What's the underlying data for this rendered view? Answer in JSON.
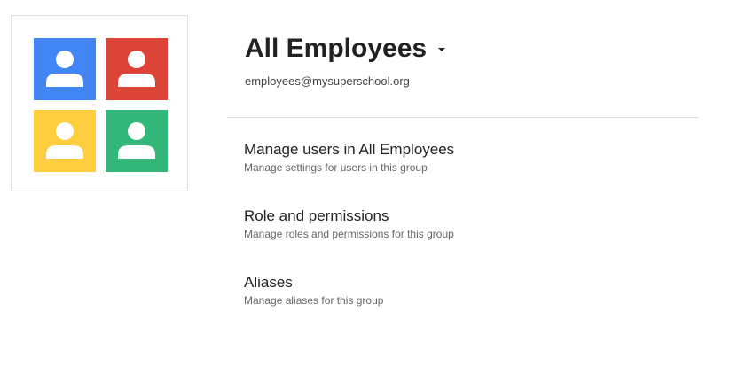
{
  "group": {
    "name": "All Employees",
    "email": "employees@mysuperschool.org"
  },
  "avatar": {
    "icon": "group-people-icon",
    "tiles": [
      {
        "color": "#4285F4",
        "icon": "person-icon"
      },
      {
        "color": "#DB4437",
        "icon": "person-icon"
      },
      {
        "color": "#FFCD40",
        "icon": "person-icon"
      },
      {
        "color": "#33B679",
        "icon": "person-icon"
      }
    ]
  },
  "menu": {
    "items": [
      {
        "title": "Manage users in All Employees",
        "description": "Manage settings for users in this group"
      },
      {
        "title": "Role and permissions",
        "description": "Manage roles and permissions for this group"
      },
      {
        "title": "Aliases",
        "description": "Manage aliases for this group"
      }
    ]
  }
}
